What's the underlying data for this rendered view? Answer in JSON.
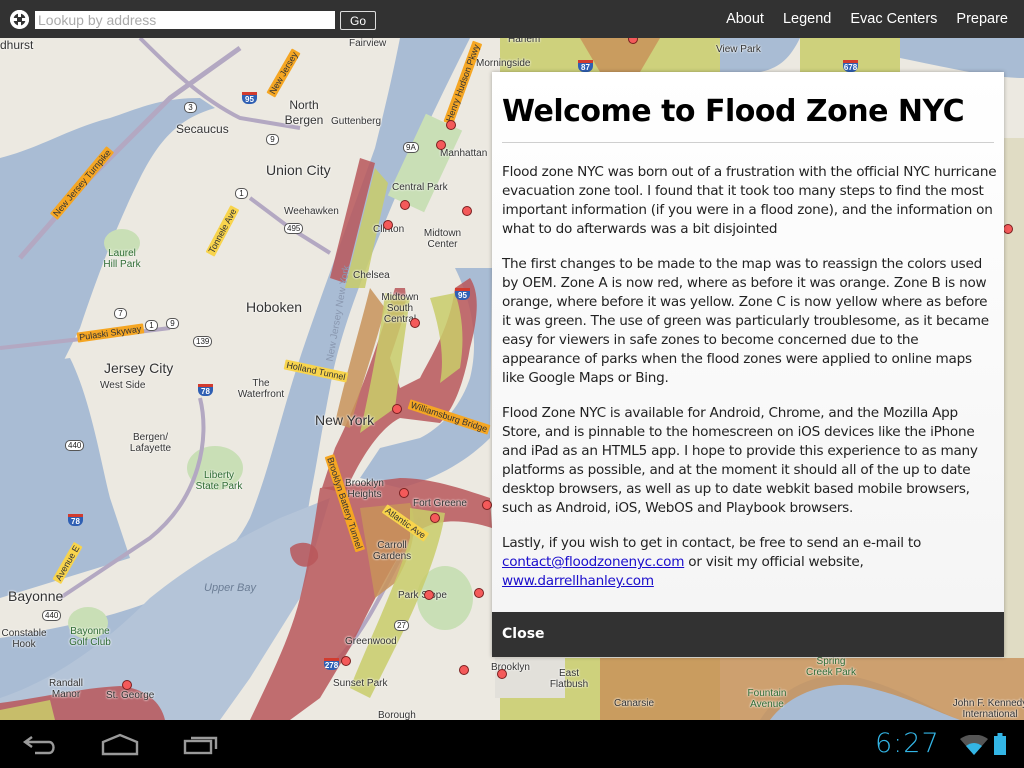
{
  "topbar": {
    "locate_icon": "crosshair-locate-icon",
    "search": {
      "placeholder": "Lookup by address",
      "value": ""
    },
    "go_label": "Go",
    "nav": [
      "About",
      "Legend",
      "Evac Centers",
      "Prepare"
    ]
  },
  "modal": {
    "title": "Welcome to Flood Zone NYC",
    "paragraphs": [
      "Flood zone NYC was born out of a frustration with the official NYC hurricane evacuation zone tool. I found that it took too many steps to find the most important information (if you were in a flood zone), and the information on what to do afterwards was a bit disjointed",
      "The first changes to be made to the map was to reassign the colors used by OEM. Zone A is now red, where as before it was orange. Zone B is now orange, where before it was yellow. Zone C is now yellow where as before it was green. The use of green was particularly troublesome, as it became easy for viewers in safe zones to become concerned due to the appearance of parks when the flood zones were applied to online maps like Google Maps or Bing.",
      "Flood Zone NYC is available for Android, Chrome, and the Mozilla App Store, and is pinnable to the homescreen on iOS devices like the iPhone and iPad as an HTML5 app. I hope to provide this experience to as many platforms as possible, and at the moment it should all of the up to date desktop browsers, as well as up to date webkit based mobile browsers, such as Android, iOS, WebOS and Playbook browsers."
    ],
    "contact": {
      "prefix": "Lastly, if you wish to get in contact, be free to send an e-mail to ",
      "email": "contact@floodzonenyc.com",
      "middle": " or visit my official website, ",
      "website": "www.darrellhanley.com"
    },
    "close_label": "Close"
  },
  "map": {
    "zone_colors": {
      "zone_a": "#b9575a",
      "zone_b": "#c8935a",
      "zone_c": "#c9cc6a"
    },
    "place_labels": [
      "dhurst",
      "Secaucus",
      "North Bergen",
      "Guttenberg",
      "Union City",
      "Weehawken",
      "Laurel Hill Park",
      "Fairview",
      "Morningside",
      "Harlem",
      "Manhattan",
      "Central Park",
      "Clinton",
      "Midtown Center",
      "Chelsea",
      "Midtown South Central",
      "Hoboken",
      "Jersey City",
      "West Side",
      "The Waterfront",
      "New York",
      "Bergen/ Lafayette",
      "Liberty State Park",
      "Brooklyn Heights",
      "Fort Greene",
      "Carroll Gardens",
      "Park Slope",
      "Greenwood",
      "Sunset Park",
      "Borough",
      "Bayonne",
      "Constable Hook",
      "Bayonne Golf Club",
      "Upper Bay",
      "Randall Manor",
      "St. George",
      "Brooklyn",
      "East Flatbush",
      "Canarsie",
      "Fountain Avenue",
      "Spring Creek Park",
      "John F. Kennedy International",
      "View Park"
    ],
    "road_labels": [
      "New Jersey Turnpike",
      "Tonnele Ave",
      "New Jersey",
      "Henry Hudson Pkwy",
      "Pulaski Skyway",
      "Holland Tunnel",
      "Williamsburg Bridge",
      "Brooklyn Battery Tunnel",
      "Atlantic Ave",
      "Avenue E",
      "New Jersey New York"
    ],
    "shields": [
      "3",
      "95",
      "9",
      "1",
      "495",
      "9A",
      "7",
      "1",
      "9",
      "139",
      "78",
      "440",
      "78",
      "440",
      "27",
      "278",
      "95",
      "87",
      "678"
    ]
  },
  "sysbar": {
    "back_icon": "back-icon",
    "home_icon": "home-icon",
    "recents_icon": "recent-apps-icon",
    "time": "6:27",
    "wifi_icon": "wifi-icon",
    "battery_icon": "battery-icon"
  }
}
